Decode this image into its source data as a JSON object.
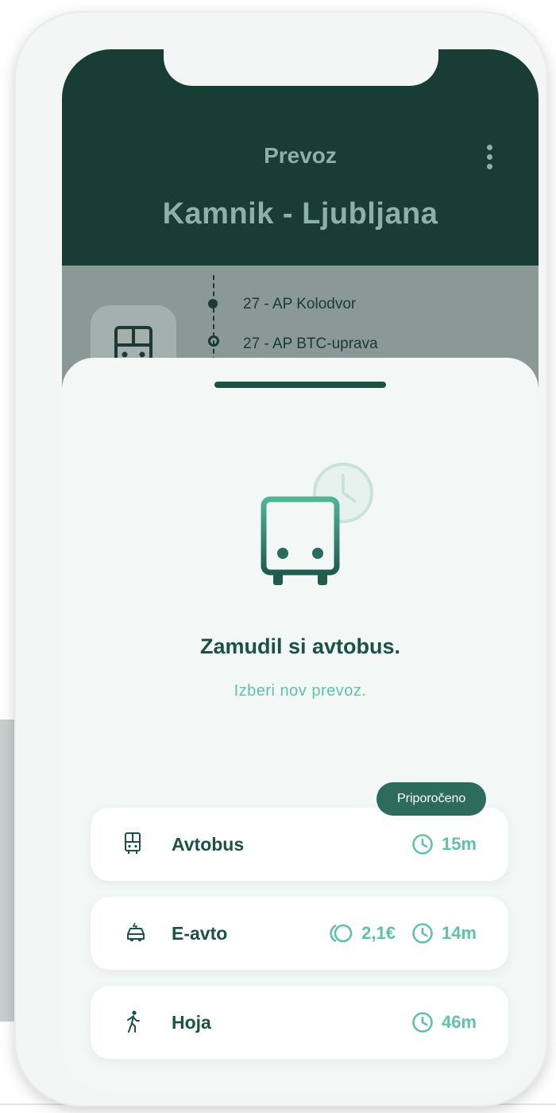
{
  "header": {
    "title": "Prevoz",
    "route": "Kamnik - Ljubljana"
  },
  "stops": [
    "27 - AP Kolodvor",
    "27 - AP BTC-uprava"
  ],
  "sheet": {
    "title": "Zamudil si avtobus.",
    "subtitle": "Izberi nov prevoz.",
    "badge": "Priporočeno",
    "options": [
      {
        "label": "Avtobus",
        "icon": "bus-icon",
        "time": "15m"
      },
      {
        "label": "E-avto",
        "icon": "car-icon",
        "cost": "2,1€",
        "time": "14m"
      },
      {
        "label": "Hoja",
        "icon": "walk-icon",
        "time": "46m"
      }
    ]
  },
  "colors": {
    "header_bg": "#173d34",
    "accent": "#5fc2a8",
    "primary_text": "#1c5245",
    "badge_bg": "#2d6b5c"
  }
}
